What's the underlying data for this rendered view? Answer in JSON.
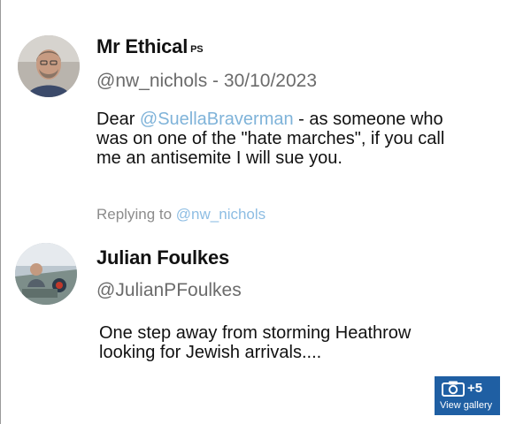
{
  "tweet": {
    "author_name": "Mr Ethical",
    "author_badge": "PS",
    "handle": "@nw_nichols",
    "separator": " - ",
    "date": "30/10/2023",
    "text_prefix": "Dear ",
    "mention": "@SuellaBraverman",
    "text_line1_rest": " - as someone who",
    "text_line2": "was on one of the \"hate marches\", if you call",
    "text_line3": "me an antisemite I will sue you."
  },
  "reply": {
    "replying_label": "Replying to",
    "replying_to": "@nw_nichols",
    "author_name": "Julian Foulkes",
    "handle": "@JulianPFoulkes",
    "text_line1": "One step away from storming Heathrow",
    "text_line2": "looking for Jewish arrivals...."
  },
  "gallery": {
    "count": "+5",
    "label": "View gallery",
    "icon": "camera-icon"
  }
}
